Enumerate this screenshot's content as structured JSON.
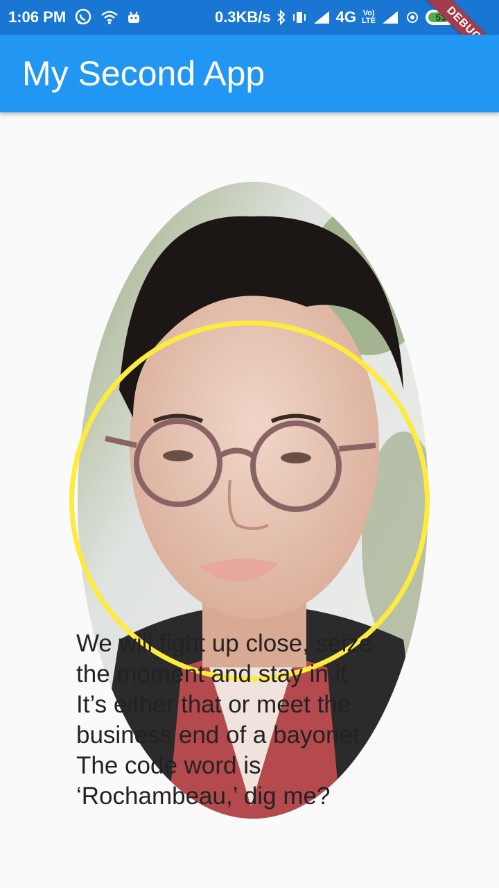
{
  "status_bar": {
    "time": "1:06 PM",
    "speed": "0.3KB/s",
    "network": "4G",
    "volte_line1": "Vo)",
    "volte_line2": "LTE",
    "battery": "53"
  },
  "app_bar": {
    "title": "My Second App"
  },
  "debug_banner": "DEBUG",
  "quote": {
    "lines": [
      "We will fight up close, seize",
      "the moment and stay in it",
      "It’s either that or meet the",
      "business end of a bayonet",
      "The code word is",
      "‘Rochambeau,’ dig me?"
    ]
  },
  "colors": {
    "status_bar": "#1976d2",
    "app_bar": "#2196f3",
    "circle": "#ffeb3b",
    "background": "#fafafa"
  },
  "icons": [
    "whatsapp-icon",
    "wifi-icon",
    "android-icon",
    "bluetooth-icon",
    "vibrate-icon",
    "signal-icon",
    "hotspot-icon",
    "battery-icon"
  ]
}
